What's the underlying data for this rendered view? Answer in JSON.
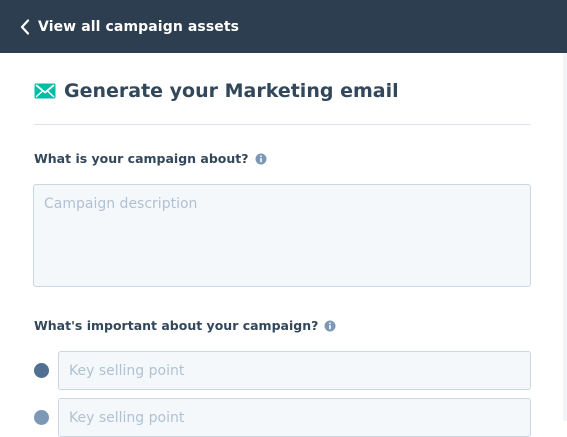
{
  "header": {
    "back_label": "View all campaign assets",
    "back_icon": "chevron-left-icon"
  },
  "main": {
    "title": "Generate your Marketing email",
    "title_icon": "email-icon",
    "campaign_about": {
      "label": "What is your campaign about?",
      "info_icon": "info-icon",
      "value": "",
      "placeholder": "Campaign description"
    },
    "important": {
      "label": "What's important about your campaign?",
      "info_icon": "info-icon",
      "selling_points": [
        {
          "value": "",
          "placeholder": "Key selling point"
        },
        {
          "value": "",
          "placeholder": "Key selling point"
        }
      ]
    }
  },
  "colors": {
    "header_bg": "#2d3e50",
    "accent_green": "#00bda5",
    "text": "#33475b",
    "input_border": "#cbd6e2",
    "input_bg": "#f5f8fa"
  }
}
